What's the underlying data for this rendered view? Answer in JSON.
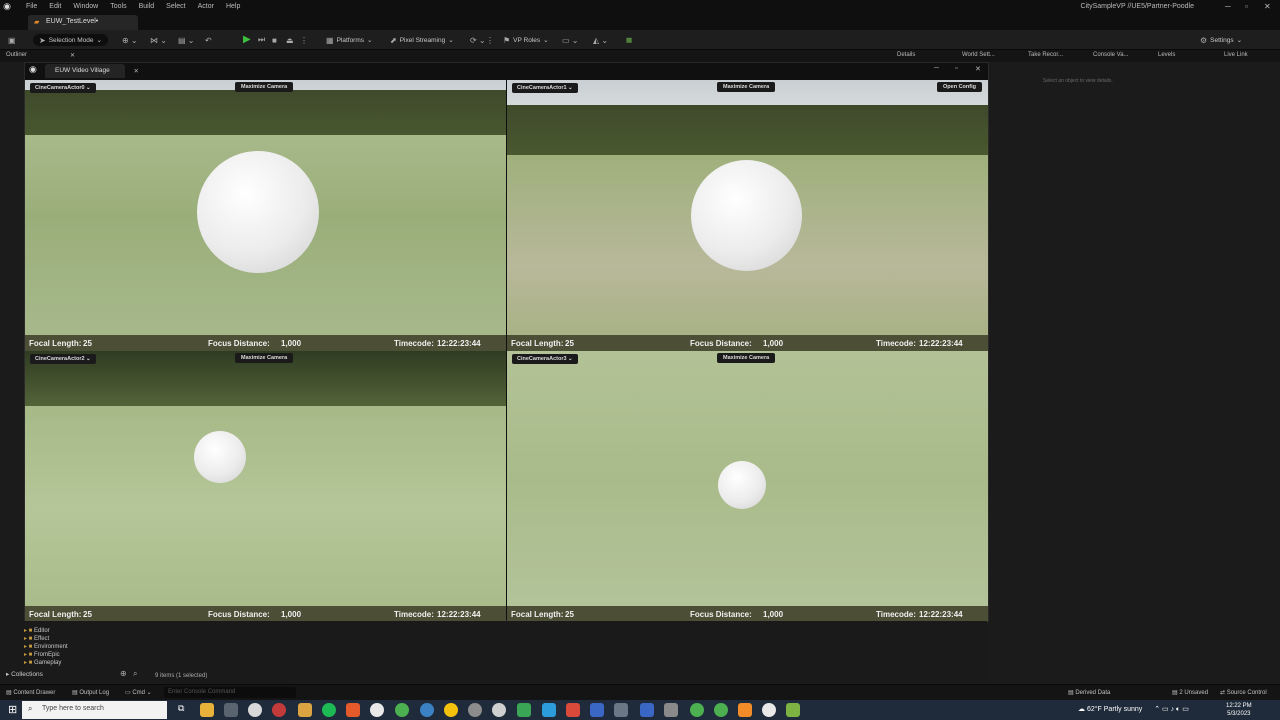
{
  "menubar": {
    "items": [
      "File",
      "Edit",
      "Window",
      "Tools",
      "Build",
      "Select",
      "Actor",
      "Help"
    ],
    "project": "CitySampleVP //UE5/Partner-Poodle"
  },
  "level_tab": {
    "label": "EUW_TestLevel•"
  },
  "toolbar": {
    "selection_mode": "Selection Mode",
    "platforms": "Platforms",
    "pixel_streaming": "Pixel Streaming",
    "vp_roles": "VP Roles",
    "settings": "Settings"
  },
  "panel_tabs": {
    "outliner": "Outliner",
    "details": "Details",
    "world_settings": "World Sett...",
    "take_recorder": "Take Recor...",
    "console_vars": "Console Va...",
    "levels": "Levels",
    "live_link": "Live Link"
  },
  "details_empty": "Select an object to view details.",
  "video_village": {
    "tab_title": "EUW Video Village",
    "maximize_label": "Maximize Camera",
    "open_config_label": "Open Config",
    "focal_label": "Focal Length:",
    "focus_label": "Focus Distance:",
    "timecode_label": "Timecode:",
    "cameras": [
      {
        "actor": "CineCameraActor0",
        "focal": "25",
        "focus": "1,000",
        "timecode": "12:22:23:44"
      },
      {
        "actor": "CineCameraActor1",
        "focal": "25",
        "focus": "1,000",
        "timecode": "12:22:23:44"
      },
      {
        "actor": "CineCameraActor2",
        "focal": "25",
        "focus": "1,000",
        "timecode": "12:22:23:44"
      },
      {
        "actor": "CineCameraActor3",
        "focal": "25",
        "focus": "1,000",
        "timecode": "12:22:23:44"
      }
    ]
  },
  "content_browser": {
    "folders": [
      "Editor",
      "Effect",
      "Environment",
      "FromEpic",
      "Gameplay"
    ],
    "collections": "Collections",
    "items_count": "9 items (1 selected)"
  },
  "statusbar": {
    "content_drawer": "Content Drawer",
    "output_log": "Output Log",
    "cmd": "Cmd",
    "console_placeholder": "Enter Console Command",
    "derived_data": "Derived Data",
    "unsaved": "2 Unsaved",
    "source_control": "Source Control"
  },
  "taskbar": {
    "search_placeholder": "Type here to search",
    "weather": "62°F  Partly sunny",
    "time": "12:22 PM",
    "date": "5/3/2023"
  }
}
